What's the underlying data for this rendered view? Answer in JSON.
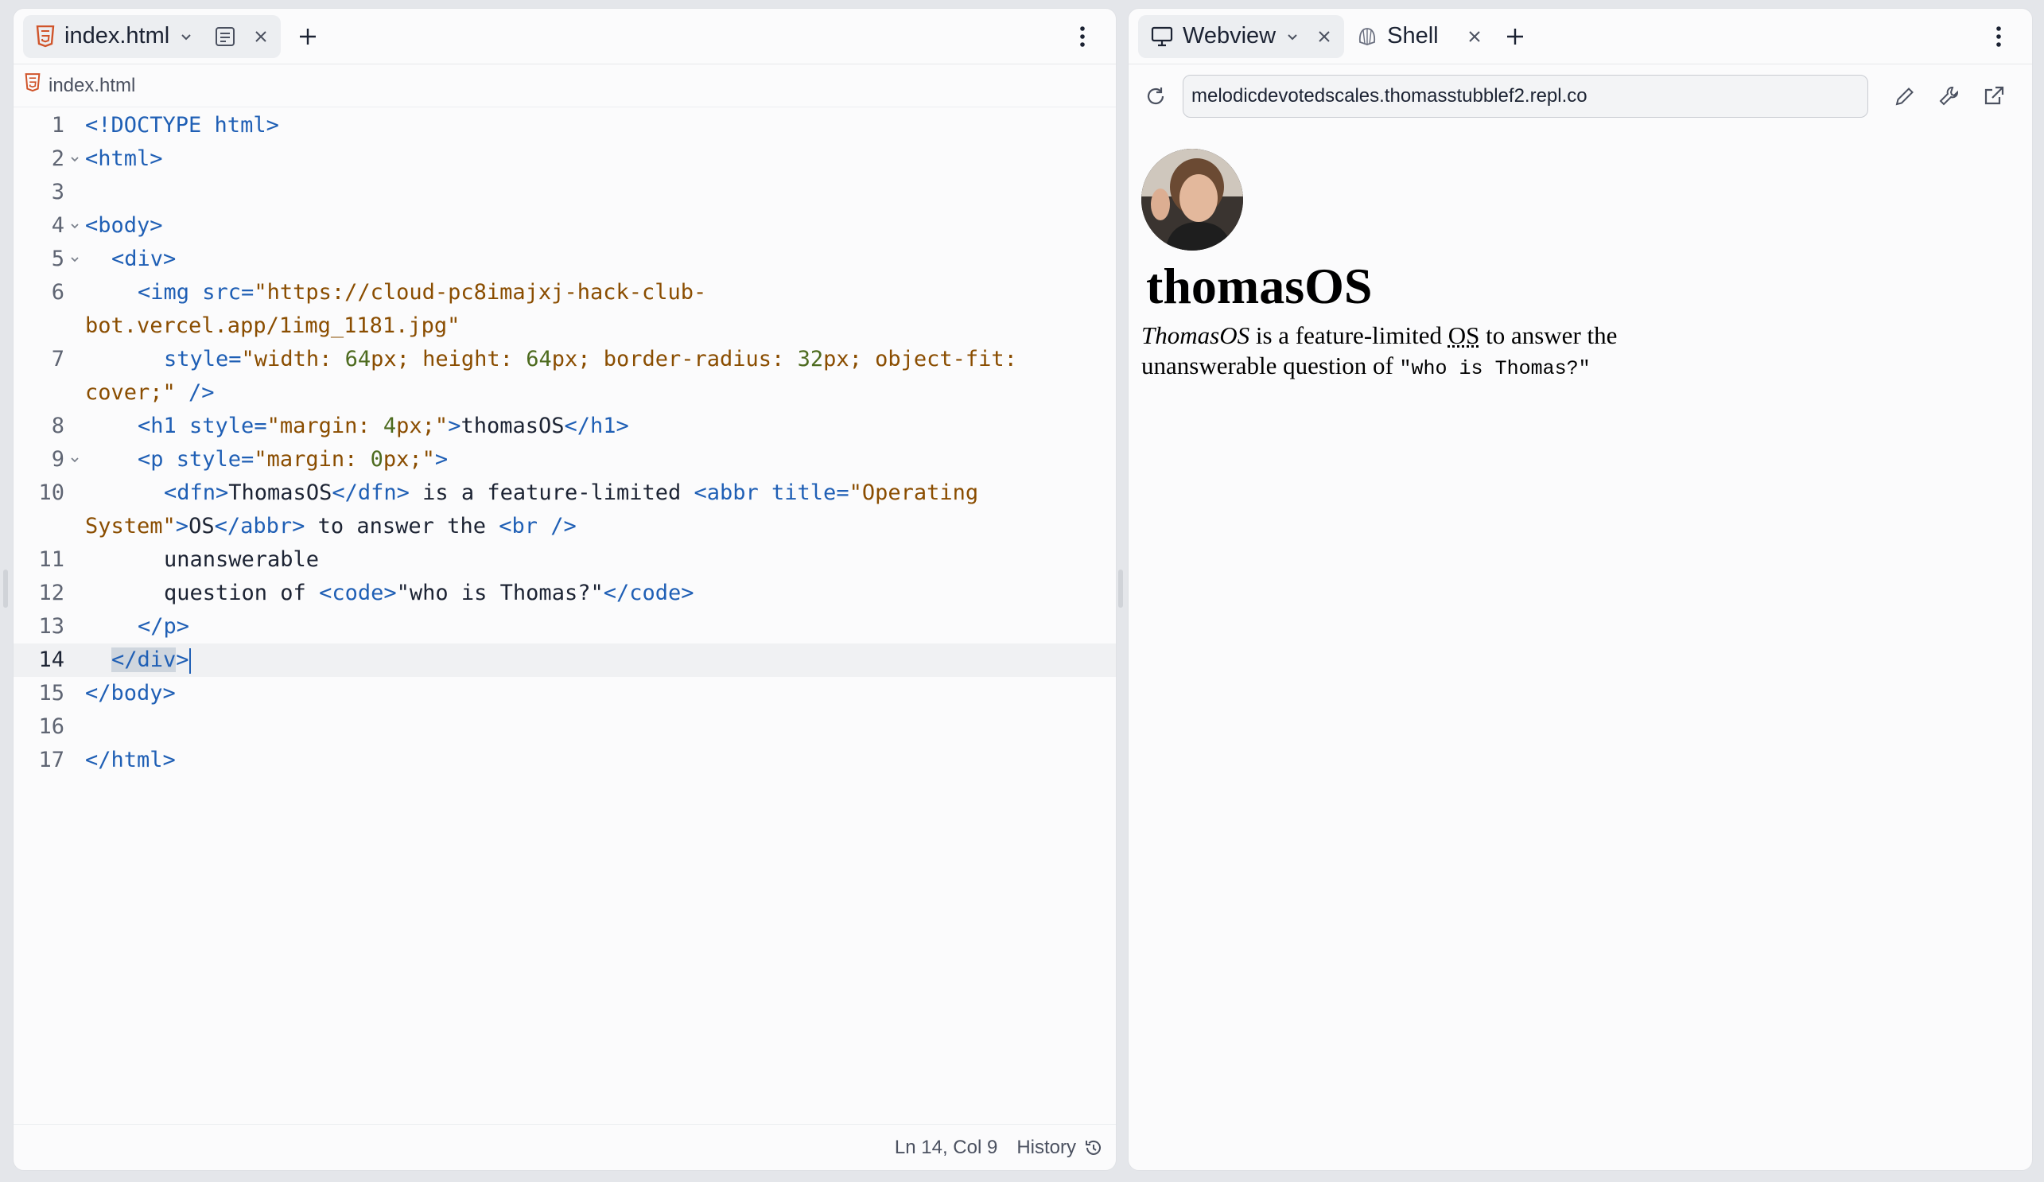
{
  "editor": {
    "tabs": [
      {
        "label": "index.html",
        "icon": "html5-icon"
      }
    ],
    "breadcrumb": "index.html",
    "lines": [
      {
        "n": "1"
      },
      {
        "n": "2"
      },
      {
        "n": "3"
      },
      {
        "n": "4"
      },
      {
        "n": "5"
      },
      {
        "n": "6"
      },
      {
        "n": "7"
      },
      {
        "n": "8"
      },
      {
        "n": "9"
      },
      {
        "n": "10"
      },
      {
        "n": "11"
      },
      {
        "n": "12"
      },
      {
        "n": "13"
      },
      {
        "n": "14"
      },
      {
        "n": "15"
      },
      {
        "n": "16"
      },
      {
        "n": "17"
      }
    ],
    "code": {
      "l1": "<!DOCTYPE html>",
      "l2": "<html>",
      "l4": "<body>",
      "l5": "<div>",
      "l6a_tag": "<img",
      "l6a_attr": " src=",
      "l6a_str": "\"https://cloud-pc8imajxj-hack-club-",
      "l6b_str": "bot.vercel.app/1img_1181.jpg\"",
      "l7a_attr": "style=",
      "l7a_1": "\"width: ",
      "l7a_n1": "64",
      "l7a_u1": "px",
      "l7a_2": "; height: ",
      "l7a_n2": "64",
      "l7a_u2": "px",
      "l7a_3": "; border-radius: ",
      "l7a_n3": "32",
      "l7a_u3": "px",
      "l7a_4": "; object-fit:",
      "l7b_1": "cover;\"",
      "l7b_tag": " />",
      "l8_tag1": "<h1",
      "l8_attr": " style=",
      "l8_s1": "\"margin: ",
      "l8_n": "4",
      "l8_u": "px",
      "l8_s2": ";\"",
      "l8_gt": ">",
      "l8_text": "thomasOS",
      "l8_tag2": "</h1>",
      "l9_tag": "<p",
      "l9_attr": " style=",
      "l9_s1": "\"margin: ",
      "l9_n": "0",
      "l9_u": "px",
      "l9_s2": ";\"",
      "l9_gt": ">",
      "l10a_t1": "<dfn>",
      "l10a_x1": "ThomasOS",
      "l10a_t2": "</dfn>",
      "l10a_x2": " is a feature-limited ",
      "l10a_t3": "<abbr",
      "l10a_attr": " title=",
      "l10a_s": "\"Operating",
      "l10b_s": "System\"",
      "l10b_gt": ">",
      "l10b_x": "OS",
      "l10b_t": "</abbr>",
      "l10b_x2": " to answer the ",
      "l10b_br": "<br />",
      "l11": "unanswerable",
      "l12_x": "question of ",
      "l12_t1": "<code>",
      "l12_x2": "\"who is Thomas?\"",
      "l12_t2": "</code>",
      "l13": "</p>",
      "l14_sel": "</div",
      "l14_gt": ">",
      "l15": "</body>",
      "l17": "</html>"
    },
    "status": {
      "position": "Ln 14, Col 9",
      "history": "History"
    }
  },
  "webview": {
    "tabs": [
      {
        "label": "Webview"
      },
      {
        "label": "Shell"
      }
    ],
    "url": "melodicdevotedscales.thomasstubblef2.repl.co",
    "site": {
      "title": "thomasOS",
      "dfn": "ThomasOS",
      "text1": " is a feature-limited ",
      "abbr": "OS",
      "abbr_title": "Operating System",
      "text2": " to answer the",
      "text3": "unanswerable question of ",
      "code": "\"who is Thomas?\""
    }
  }
}
